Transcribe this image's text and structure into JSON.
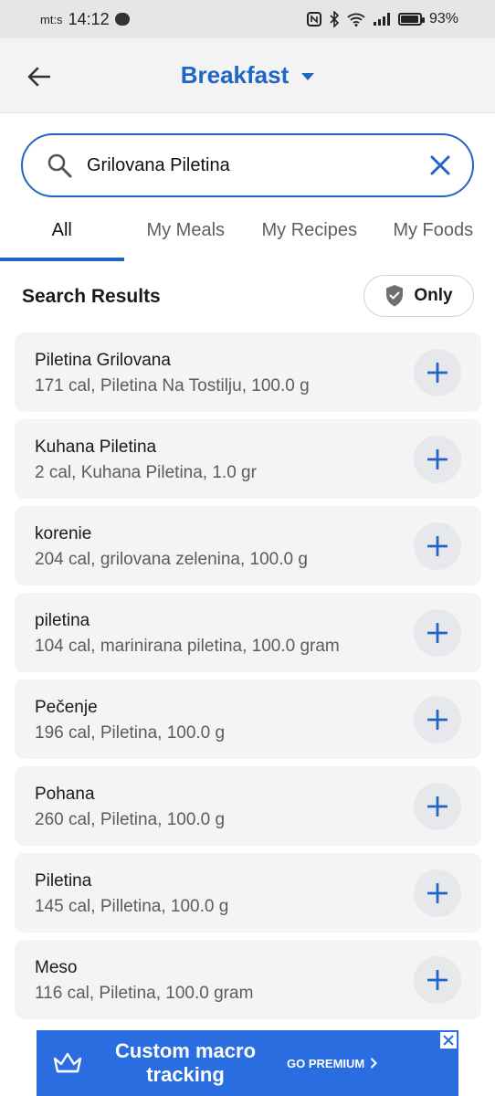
{
  "status": {
    "carrier": "mt:s",
    "time": "14:12",
    "battery": "93%",
    "battery_level": 0.93
  },
  "header": {
    "title": "Breakfast"
  },
  "search": {
    "value": "Grilovana Piletina"
  },
  "tabs": [
    {
      "label": "All"
    },
    {
      "label": "My Meals"
    },
    {
      "label": "My Recipes"
    },
    {
      "label": "My Foods"
    }
  ],
  "results": {
    "title": "Search Results",
    "only_label": "Only"
  },
  "items": [
    {
      "name": "Piletina Grilovana",
      "desc": "171 cal, Piletina Na Tostilju, 100.0 g"
    },
    {
      "name": "Kuhana Piletina",
      "desc": "2 cal, Kuhana Piletina, 1.0 gr"
    },
    {
      "name": "korenie",
      "desc": "204 cal, grilovana zelenina, 100.0 g"
    },
    {
      "name": "piletina",
      "desc": "104 cal, marinirana piletina, 100.0 gram"
    },
    {
      "name": "Pečenje",
      "desc": "196 cal, Piletina, 100.0 g"
    },
    {
      "name": "Pohana",
      "desc": "260 cal, Piletina, 100.0 g"
    },
    {
      "name": "Piletina",
      "desc": "145 cal, Pilletina, 100.0 g"
    },
    {
      "name": "Meso",
      "desc": "116 cal, Piletina, 100.0 gram"
    }
  ],
  "ad": {
    "line1": "Custom macro",
    "line2": "tracking",
    "cta": "GO PREMIUM"
  },
  "colors": {
    "accent": "#1f65c6",
    "ad_background": "#2a6de0"
  }
}
